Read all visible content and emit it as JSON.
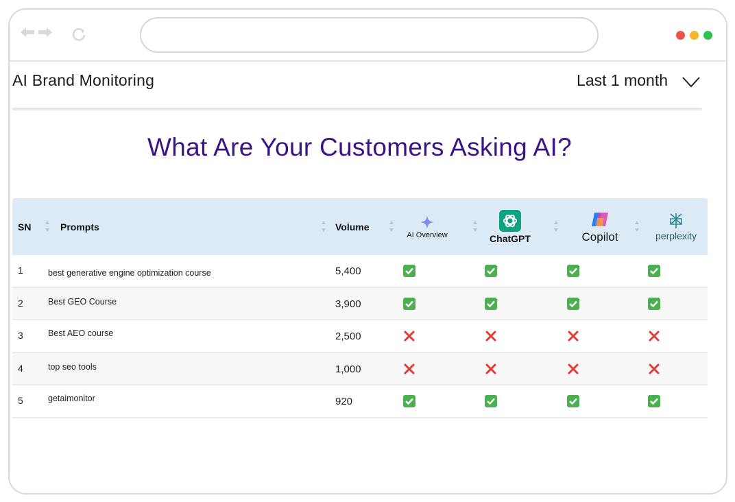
{
  "header": {
    "title": "AI Brand Monitoring",
    "range": "Last 1 month"
  },
  "headline": "What Are Your Customers Asking AI?",
  "table": {
    "columns": {
      "sn": "SN",
      "prompts": "Prompts",
      "volume": "Volume",
      "ai_overview": "AI Overview",
      "chatgpt": "ChatGPT",
      "copilot": "Copilot",
      "perplexity": "perplexity"
    },
    "rows": [
      {
        "sn": "1",
        "prompt": "best generative engine optimization course",
        "volume": "5,400",
        "results": [
          true,
          true,
          true,
          true
        ]
      },
      {
        "sn": "2",
        "prompt": "Best GEO Course",
        "volume": "3,900",
        "results": [
          true,
          true,
          true,
          true
        ]
      },
      {
        "sn": "3",
        "prompt": "Best AEO course",
        "volume": "2,500",
        "results": [
          false,
          false,
          false,
          false
        ]
      },
      {
        "sn": "4",
        "prompt": "top seo tools",
        "volume": "1,000",
        "results": [
          false,
          false,
          false,
          false
        ]
      },
      {
        "sn": "5",
        "prompt": "getaimonitor",
        "volume": "920",
        "results": [
          true,
          true,
          true,
          true
        ]
      }
    ]
  },
  "colors": {
    "headline": "#3a1484",
    "table_header": "#dceaf5",
    "check": "#4caf50",
    "cross": "#e53935",
    "dot_red": "#f0504a",
    "dot_yellow": "#f7b52c",
    "dot_green": "#2fc24f"
  }
}
